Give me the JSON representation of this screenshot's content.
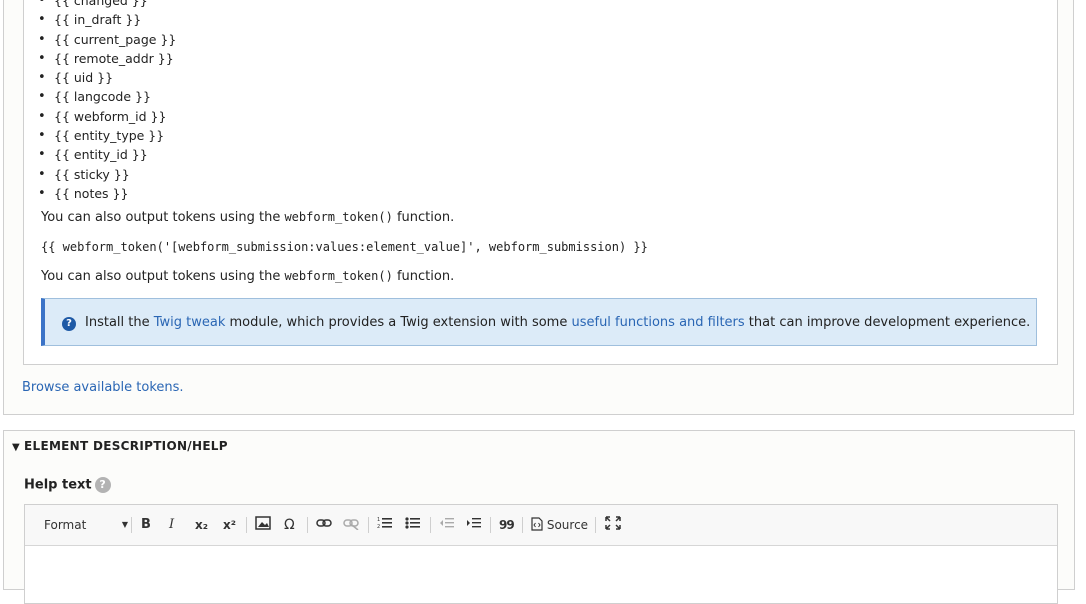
{
  "variables": [
    "{{ changed }}",
    "{{ in_draft }}",
    "{{ current_page }}",
    "{{ remote_addr }}",
    "{{ uid }}",
    "{{ langcode }}",
    "{{ webform_id }}",
    "{{ entity_type }}",
    "{{ entity_id }}",
    "{{ sticky }}",
    "{{ notes }}"
  ],
  "para1_prefix": "You can also output tokens using the ",
  "para1_code": "webform_token()",
  "para1_suffix": " function.",
  "code_example": "{{ webform_token('[webform_submission:values:element_value]', webform_submission) }}",
  "para2_prefix": "You can also output tokens using the ",
  "para2_code": "webform_token()",
  "para2_suffix": " function.",
  "info": {
    "prefix": "Install the ",
    "link1": "Twig tweak",
    "middle": " module, which provides a Twig extension with some ",
    "link2": "useful functions and filters",
    "suffix": " that can improve development experience."
  },
  "browse_link": "Browse available tokens.",
  "section_title": "ELEMENT DESCRIPTION/HELP",
  "help_label": "Help text",
  "toolbar": {
    "format": "Format",
    "bold": "B",
    "italic": "I",
    "subscript": "x₂",
    "superscript": "x²",
    "omega": "Ω",
    "quote": "99",
    "source": "Source"
  }
}
